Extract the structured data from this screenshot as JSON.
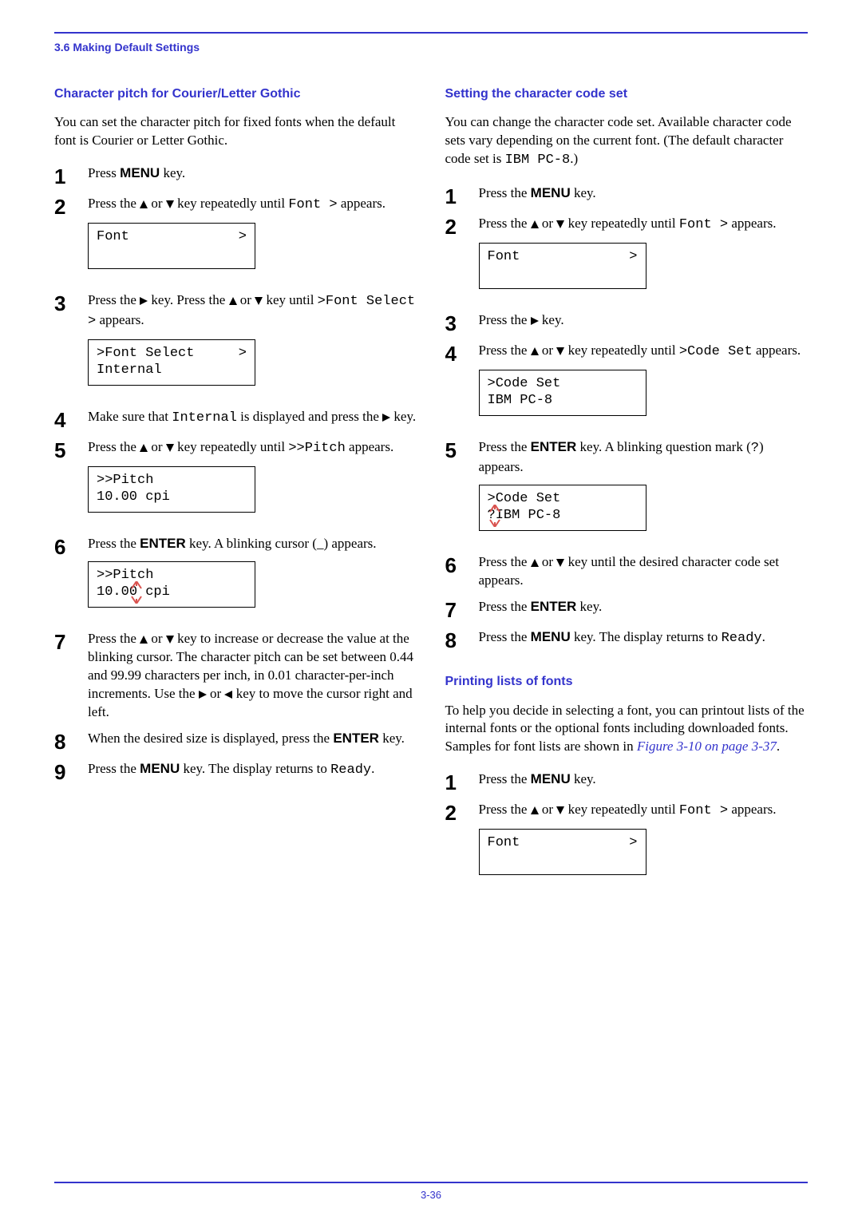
{
  "header": {
    "section_title": "3.6 Making Default Settings"
  },
  "left": {
    "h": "Character pitch for Courier/Letter Gothic",
    "intro": "You can set the character pitch for fixed fonts when the default font is Courier or Letter Gothic.",
    "s1": {
      "a": "Press ",
      "menu": "MENU",
      "b": " key."
    },
    "s2": {
      "a": "Press the ",
      "b": " or ",
      "c": " key repeatedly until ",
      "code": "Font >",
      "d": " appears."
    },
    "lcd1a": "Font",
    "lcd1b": ">",
    "s3": {
      "a": "Press the ",
      "b": " key. Press the ",
      "c": " or ",
      "d": " key until ",
      "code": ">Font Select >",
      "e": " appears."
    },
    "lcd2a": ">Font Select",
    "lcd2b": ">",
    "lcd2c": "  Internal",
    "s4": {
      "a": "Make sure that ",
      "code": "Internal",
      "b": " is displayed and press the ",
      "c": " key."
    },
    "s5": {
      "a": "Press the ",
      "b": " or ",
      "c": " key repeatedly until ",
      "code": ">>Pitch",
      "d": " appears."
    },
    "lcd3a": ">>Pitch",
    "lcd3b": "       10.00 cpi",
    "s6": {
      "a": "Press the ",
      "enter": "ENTER",
      "b": " key. A blinking cursor (",
      "c": "_",
      "d": ") appears."
    },
    "lcd4a": ">>Pitch",
    "lcd4b_pre": "       10.0",
    "lcd4b_cur": "0",
    "lcd4b_post": " cpi",
    "s7": "Press the △ or ▽ key to increase or decrease the value at the blinking cursor. The character pitch can be set between 0.44 and 99.99 characters per inch, in 0.01 character-per-inch increments. Use the ▷ or ◁ key to move the cursor right and left.",
    "s7a": "Press the ",
    "s7b": " or ",
    "s7c": " key to increase or decrease the value at the blinking cursor. The character pitch can be set between 0.44 and 99.99 characters per inch, in 0.01 character-per-inch increments. Use the ",
    "s7d": " or ",
    "s7e": " key to move the cursor right and left.",
    "s8": {
      "a": "When the desired size is displayed, press the ",
      "enter": "ENTER",
      "b": " key."
    },
    "s9": {
      "a": "Press the ",
      "menu": "MENU",
      "b": " key. The display returns to ",
      "code": "Ready",
      "c": "."
    }
  },
  "right": {
    "h": "Setting the character code set",
    "intro_a": "You can change the character code set. Available character code sets vary depending on the current font. (The default character code set is ",
    "intro_code": "IBM PC-8",
    "intro_b": ".)",
    "s1": {
      "a": "Press the ",
      "menu": "MENU",
      "b": " key."
    },
    "s2": {
      "a": "Press the ",
      "b": " or ",
      "c": " key repeatedly until ",
      "code": "Font >",
      "d": " appears."
    },
    "lcd1a": "Font",
    "lcd1b": ">",
    "s3": {
      "a": "Press the ",
      "b": " key."
    },
    "s4": {
      "a": "Press the ",
      "b": " or ",
      "c": " key repeatedly until ",
      "code": ">Code Set",
      "d": " appears."
    },
    "lcd2a": ">Code Set",
    "lcd2b": " IBM PC-8",
    "s5": {
      "a": "Press the ",
      "enter": "ENTER",
      "b": " key. A blinking question mark (",
      "q": "?",
      "c": ") appears."
    },
    "lcd3a": ">Code Set",
    "lcd3b_pre": "",
    "lcd3b_cur": "?",
    "lcd3b_post": "IBM PC-8",
    "s6": {
      "a": "Press the ",
      "b": " or ",
      "c": " key until the desired character code set appears."
    },
    "s7": {
      "a": "Press the ",
      "enter": "ENTER",
      "b": " key."
    },
    "s8": {
      "a": "Press the ",
      "menu": "MENU",
      "b": " key. The display returns to ",
      "code": "Ready",
      "c": "."
    },
    "h2": "Printing lists of fonts",
    "intro2": "To help you decide in selecting a font, you can printout lists of the internal fonts or the optional fonts including downloaded fonts. Samples for font lists are shown in ",
    "link": "Figure 3-10 on page 3-37",
    "intro2_end": ".",
    "bs1": {
      "a": "Press the ",
      "menu": "MENU",
      "b": " key."
    },
    "bs2": {
      "a": "Press the ",
      "b": " or ",
      "c": " key repeatedly until ",
      "code": "Font >",
      "d": " appears."
    },
    "lcd4a": "Font",
    "lcd4b": ">"
  },
  "page": "3-36"
}
